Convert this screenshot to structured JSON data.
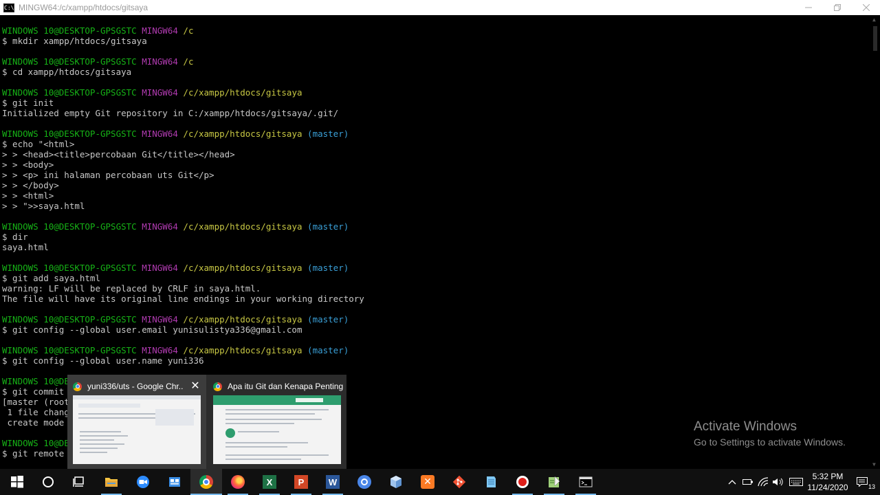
{
  "window": {
    "title": "MINGW64:/c/xampp/htdocs/gitsaya",
    "icon_text": "C:\\"
  },
  "terminal": {
    "lines": [
      {
        "y": 0,
        "segments": [
          {
            "t": "WINDOWS 10@DESKTOP-GPSGSTC ",
            "c": "u"
          },
          {
            "t": "MINGW64 ",
            "c": "m"
          },
          {
            "t": "/c",
            "c": "p"
          }
        ]
      },
      {
        "y": 1,
        "segments": [
          {
            "t": "$ mkdir xampp/htdocs/gitsaya",
            "c": ""
          }
        ]
      },
      {
        "y": 3,
        "segments": [
          {
            "t": "WINDOWS 10@DESKTOP-GPSGSTC ",
            "c": "u"
          },
          {
            "t": "MINGW64 ",
            "c": "m"
          },
          {
            "t": "/c",
            "c": "p"
          }
        ]
      },
      {
        "y": 4,
        "segments": [
          {
            "t": "$ cd xampp/htdocs/gitsaya",
            "c": ""
          }
        ]
      },
      {
        "y": 6,
        "segments": [
          {
            "t": "WINDOWS 10@DESKTOP-GPSGSTC ",
            "c": "u"
          },
          {
            "t": "MINGW64 ",
            "c": "m"
          },
          {
            "t": "/c/xampp/htdocs/gitsaya",
            "c": "p"
          }
        ]
      },
      {
        "y": 7,
        "segments": [
          {
            "t": "$ git init",
            "c": ""
          }
        ]
      },
      {
        "y": 8,
        "segments": [
          {
            "t": "Initialized empty Git repository in C:/xampp/htdocs/gitsaya/.git/",
            "c": ""
          }
        ]
      },
      {
        "y": 10,
        "segments": [
          {
            "t": "WINDOWS 10@DESKTOP-GPSGSTC ",
            "c": "u"
          },
          {
            "t": "MINGW64 ",
            "c": "m"
          },
          {
            "t": "/c/xampp/htdocs/gitsaya ",
            "c": "p"
          },
          {
            "t": "(master)",
            "c": "b"
          }
        ]
      },
      {
        "y": 11,
        "segments": [
          {
            "t": "$ echo \"<html>",
            "c": ""
          }
        ]
      },
      {
        "y": 12,
        "segments": [
          {
            "t": "> > <head><title>percobaan Git</title></head>",
            "c": ""
          }
        ]
      },
      {
        "y": 13,
        "segments": [
          {
            "t": "> > <body>",
            "c": ""
          }
        ]
      },
      {
        "y": 14,
        "segments": [
          {
            "t": "> > <p> ini halaman percobaan uts Git</p>",
            "c": ""
          }
        ]
      },
      {
        "y": 15,
        "segments": [
          {
            "t": "> > </body>",
            "c": ""
          }
        ]
      },
      {
        "y": 16,
        "segments": [
          {
            "t": "> > <html>",
            "c": ""
          }
        ]
      },
      {
        "y": 17,
        "segments": [
          {
            "t": "> > \">>saya.html",
            "c": ""
          }
        ]
      },
      {
        "y": 19,
        "segments": [
          {
            "t": "WINDOWS 10@DESKTOP-GPSGSTC ",
            "c": "u"
          },
          {
            "t": "MINGW64 ",
            "c": "m"
          },
          {
            "t": "/c/xampp/htdocs/gitsaya ",
            "c": "p"
          },
          {
            "t": "(master)",
            "c": "b"
          }
        ]
      },
      {
        "y": 20,
        "segments": [
          {
            "t": "$ dir",
            "c": ""
          }
        ]
      },
      {
        "y": 21,
        "segments": [
          {
            "t": "saya.html",
            "c": ""
          }
        ]
      },
      {
        "y": 23,
        "segments": [
          {
            "t": "WINDOWS 10@DESKTOP-GPSGSTC ",
            "c": "u"
          },
          {
            "t": "MINGW64 ",
            "c": "m"
          },
          {
            "t": "/c/xampp/htdocs/gitsaya ",
            "c": "p"
          },
          {
            "t": "(master)",
            "c": "b"
          }
        ]
      },
      {
        "y": 24,
        "segments": [
          {
            "t": "$ git add saya.html",
            "c": ""
          }
        ]
      },
      {
        "y": 25,
        "segments": [
          {
            "t": "warning: LF will be replaced by CRLF in saya.html.",
            "c": ""
          }
        ]
      },
      {
        "y": 26,
        "segments": [
          {
            "t": "The file will have its original line endings in your working directory",
            "c": ""
          }
        ]
      },
      {
        "y": 28,
        "segments": [
          {
            "t": "WINDOWS 10@DESKTOP-GPSGSTC ",
            "c": "u"
          },
          {
            "t": "MINGW64 ",
            "c": "m"
          },
          {
            "t": "/c/xampp/htdocs/gitsaya ",
            "c": "p"
          },
          {
            "t": "(master)",
            "c": "b"
          }
        ]
      },
      {
        "y": 29,
        "segments": [
          {
            "t": "$ git config --global user.email yunisulistya336@gmail.com",
            "c": ""
          }
        ]
      },
      {
        "y": 31,
        "segments": [
          {
            "t": "WINDOWS 10@DESKTOP-GPSGSTC ",
            "c": "u"
          },
          {
            "t": "MINGW64 ",
            "c": "m"
          },
          {
            "t": "/c/xampp/htdocs/gitsaya ",
            "c": "p"
          },
          {
            "t": "(master)",
            "c": "b"
          }
        ]
      },
      {
        "y": 32,
        "segments": [
          {
            "t": "$ git config --global user.name yuni336",
            "c": ""
          }
        ]
      },
      {
        "y": 34,
        "segments": [
          {
            "t": "WINDOWS 10@DE",
            "c": "u"
          }
        ]
      },
      {
        "y": 35,
        "segments": [
          {
            "t": "$ git commit",
            "c": ""
          }
        ]
      },
      {
        "y": 36,
        "segments": [
          {
            "t": "[master (root",
            "c": ""
          }
        ]
      },
      {
        "y": 37,
        "segments": [
          {
            "t": " 1 file chang",
            "c": ""
          }
        ]
      },
      {
        "y": 38,
        "segments": [
          {
            "t": " create mode ",
            "c": ""
          }
        ]
      },
      {
        "y": 40,
        "segments": [
          {
            "t": "WINDOWS 10@DE",
            "c": "u"
          }
        ]
      },
      {
        "y": 41,
        "segments": [
          {
            "t": "$ git remote ",
            "c": ""
          }
        ]
      }
    ]
  },
  "watermark": {
    "title": "Activate Windows",
    "subtitle": "Go to Settings to activate Windows."
  },
  "preview": {
    "items": [
      {
        "label": "yuni336/uts - Google Chr...",
        "close": "✕"
      },
      {
        "label": "Apa itu Git dan Kenapa Penting..."
      }
    ]
  },
  "taskbar": {
    "icons": [
      "windows-start-icon",
      "search-icon",
      "task-view-icon",
      "file-explorer-icon",
      "zoom-icon",
      "store-icon",
      "chrome-icon",
      "firefox-icon",
      "excel-icon",
      "powerpoint-icon",
      "word-icon",
      "chrome-alt-icon",
      "box-icon",
      "xampp-icon",
      "git-icon",
      "notepad-icon",
      "record-icon",
      "notepad-plus-icon",
      "terminal-icon"
    ],
    "active": "chrome-icon",
    "tray": {
      "time": "5:32 PM",
      "date": "11/24/2020",
      "notifications": "13"
    }
  }
}
